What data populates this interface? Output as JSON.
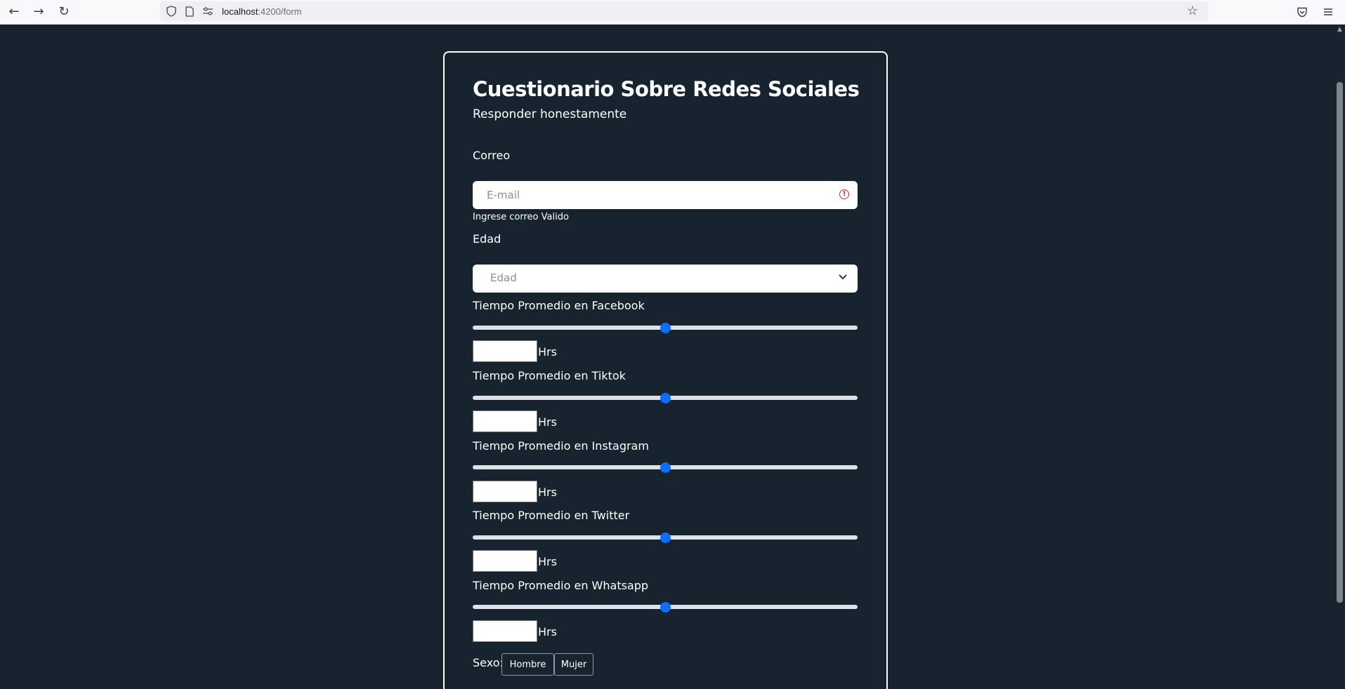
{
  "browser": {
    "url_host": "localhost",
    "url_path": ":4200/form"
  },
  "form": {
    "title": "Cuestionario Sobre Redes Sociales",
    "subtitle": "Responder honestamente",
    "email": {
      "label": "Correo",
      "placeholder": "E-mail",
      "value": "",
      "helper": "Ingrese correo Valido",
      "error_color": "#d7263d"
    },
    "age": {
      "label": "Edad",
      "placeholder": "Edad"
    },
    "sliders": [
      {
        "label": "Tiempo Promedio en Facebook",
        "level": 0.5,
        "value": "",
        "unit": "Hrs"
      },
      {
        "label": "Tiempo Promedio en Tiktok",
        "level": 0.5,
        "value": "",
        "unit": "Hrs"
      },
      {
        "label": "Tiempo Promedio en Instagram",
        "level": 0.5,
        "value": "",
        "unit": "Hrs"
      },
      {
        "label": "Tiempo Promedio en Twitter",
        "level": 0.5,
        "value": "",
        "unit": "Hrs"
      },
      {
        "label": "Tiempo Promedio en Whatsapp",
        "level": 0.5,
        "value": "",
        "unit": "Hrs"
      }
    ],
    "sex": {
      "label": "Sexo:",
      "options": [
        "Hombre",
        "Mujer"
      ]
    }
  },
  "colors": {
    "background": "#17242f",
    "slider_accent": "#0d6efd",
    "card_border": "#ffffff"
  }
}
